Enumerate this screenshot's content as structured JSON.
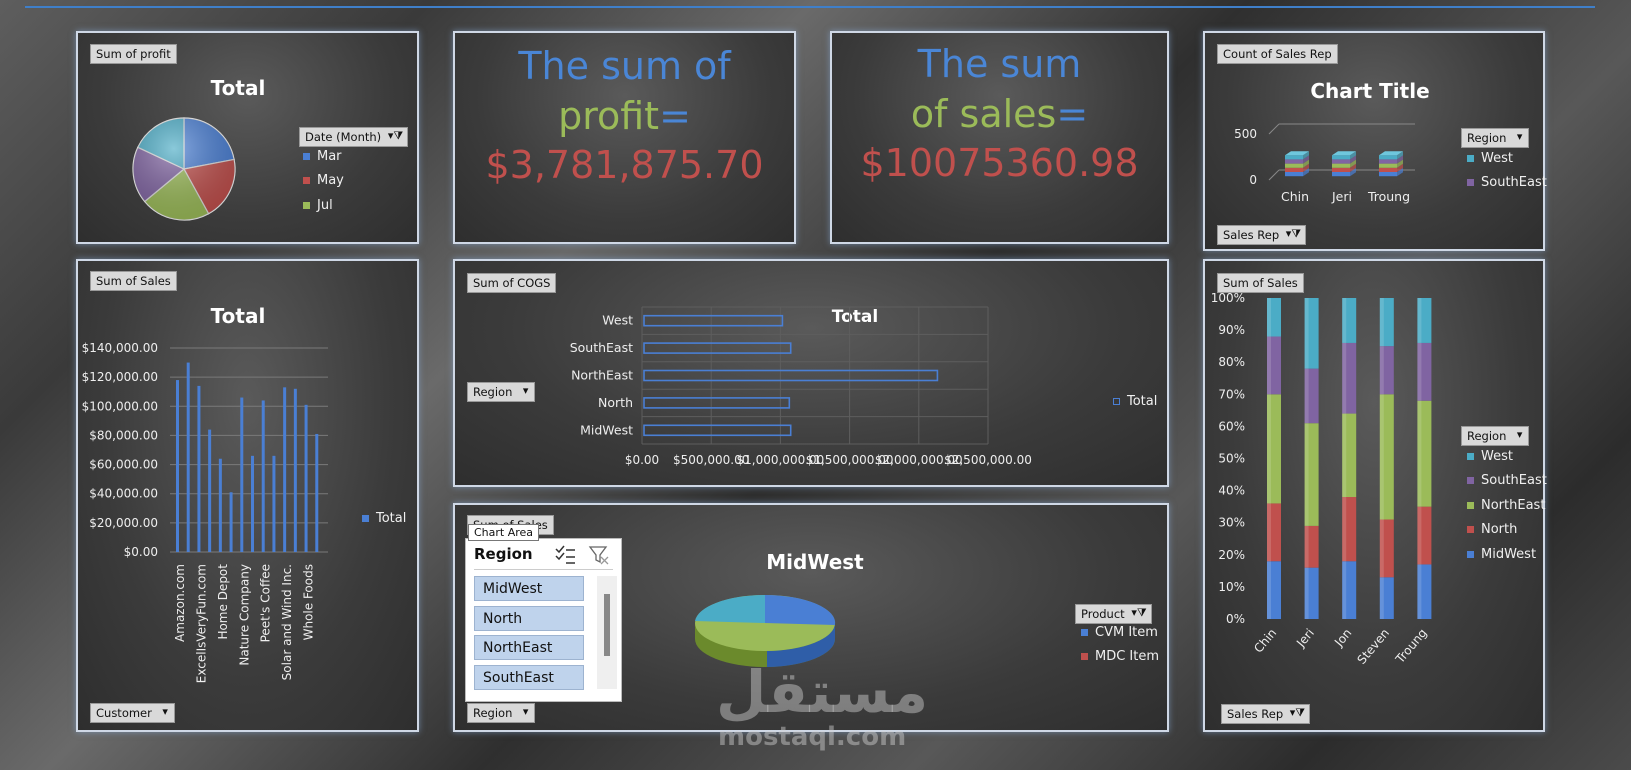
{
  "kpi_profit": {
    "line1": "The sum of",
    "line2a": "profit",
    "line2b": "=",
    "value": "$3,781,875.70"
  },
  "kpi_sales": {
    "line1": "The sum",
    "line2a": "of sales",
    "line2b": "=",
    "value": "$10075360.98"
  },
  "colors": {
    "blue": "#4a7fd4",
    "green": "#9bbb59",
    "red": "#c0504d",
    "panel_border": "#cfd8e6",
    "accent_line": "#3f7fc9"
  },
  "profit_pie": {
    "tag": "Sum of profit",
    "filter": "Date (Month)",
    "chart_data": {
      "type": "pie",
      "title": "Total",
      "categories": [
        "Mar",
        "May",
        "Jul"
      ],
      "slices": [
        {
          "label": "Mar",
          "value": 22,
          "color": "#4a7fd4"
        },
        {
          "label": "May",
          "value": 20,
          "color": "#c0504d"
        },
        {
          "label": "Jul",
          "value": 22,
          "color": "#9bbb59"
        },
        {
          "label": "",
          "value": 18,
          "color": "#8064a2"
        },
        {
          "label": "",
          "value": 18,
          "color": "#4bacc6"
        }
      ]
    }
  },
  "sales_rep_count": {
    "tag": "Count of Sales Rep",
    "filter_region": "Region",
    "filter_rep": "Sales Rep",
    "chart_data": {
      "type": "bar",
      "title": "Chart Title",
      "categories": [
        "Chin",
        "Jeri",
        "Troung"
      ],
      "ylim": [
        0,
        500
      ],
      "yticks": [
        "0",
        "500"
      ],
      "series": [
        {
          "name": "West",
          "color": "#4bacc6"
        },
        {
          "name": "SouthEast",
          "color": "#8064a2"
        }
      ]
    }
  },
  "sales_customer": {
    "tag": "Sum of Sales",
    "filter": "Customer",
    "chart_data": {
      "type": "bar",
      "title": "Total",
      "legend": "Total",
      "ylim": [
        0,
        140000
      ],
      "yticks": [
        "$0.00",
        "$20,000.00",
        "$40,000.00",
        "$60,000.00",
        "$80,000.00",
        "$100,000.00",
        "$120,000.00",
        "$140,000.00"
      ],
      "values": [
        118000,
        130000,
        114000,
        84000,
        64000,
        41000,
        106000,
        66000,
        104000,
        66000,
        113000,
        112000,
        101000,
        81000
      ],
      "labels": [
        "Amazon.com",
        "ExcelIsVeryFun.com",
        "Home Depot",
        "Nature Company",
        "Peet's Coffee",
        "Solar and Wind Inc.",
        "Whole Foods"
      ]
    }
  },
  "cogs": {
    "tag": "Sum of COGS",
    "filter": "Region",
    "chart_data": {
      "type": "bar",
      "orientation": "horizontal",
      "title": "Total",
      "legend": "Total",
      "categories": [
        "West",
        "SouthEast",
        "NorthEast",
        "North",
        "MidWest"
      ],
      "values": [
        1000000,
        1060000,
        2120000,
        1050000,
        1060000
      ],
      "xlim": [
        0,
        2500000
      ],
      "xticks": [
        "$0.00",
        "$500,000.00",
        "$1,000,000.00",
        "$1,500,000.00",
        "$2,000,000.00",
        "$2,500,000.00"
      ]
    }
  },
  "midwest": {
    "tag": "Sum of Sales",
    "tooltip": "Chart Area",
    "filter_region": "Region",
    "filter_product": "Product",
    "slicer": {
      "title": "Region",
      "items": [
        "MidWest",
        "North",
        "NorthEast",
        "SouthEast"
      ]
    },
    "chart_data": {
      "type": "pie",
      "title": "MidWest",
      "slices": [
        {
          "label": "CVM Item",
          "value": 50,
          "color": "#4a7fd4"
        },
        {
          "label": "",
          "value": 50,
          "color": "#9bbb59"
        }
      ],
      "legend": [
        {
          "label": "CVM Item",
          "color": "#4a7fd4"
        },
        {
          "label": "MDC Item",
          "color": "#c0504d"
        }
      ]
    }
  },
  "stacked": {
    "tag": "Sum of Sales",
    "filter_region": "Region",
    "filter_rep": "Sales Rep",
    "chart_data": {
      "type": "bar",
      "stacked": "percent",
      "categories": [
        "Chin",
        "Jeri",
        "Jon",
        "Steven",
        "Troung"
      ],
      "yticks": [
        "0%",
        "10%",
        "20%",
        "30%",
        "40%",
        "50%",
        "60%",
        "70%",
        "80%",
        "90%",
        "100%"
      ],
      "series": [
        {
          "name": "MidWest",
          "color": "#4a7fd4",
          "values": [
            18,
            16,
            18,
            13,
            17
          ]
        },
        {
          "name": "North",
          "color": "#c0504d",
          "values": [
            18,
            13,
            20,
            18,
            18
          ]
        },
        {
          "name": "NorthEast",
          "color": "#9bbb59",
          "values": [
            34,
            32,
            26,
            39,
            33
          ]
        },
        {
          "name": "SouthEast",
          "color": "#8064a2",
          "values": [
            18,
            17,
            22,
            15,
            18
          ]
        },
        {
          "name": "West",
          "color": "#4bacc6",
          "values": [
            12,
            22,
            14,
            15,
            14
          ]
        }
      ],
      "legend": [
        "West",
        "SouthEast",
        "NorthEast",
        "North",
        "MidWest"
      ]
    }
  },
  "watermark": {
    "logo": "مستقل",
    "site": "mostaql.com"
  }
}
